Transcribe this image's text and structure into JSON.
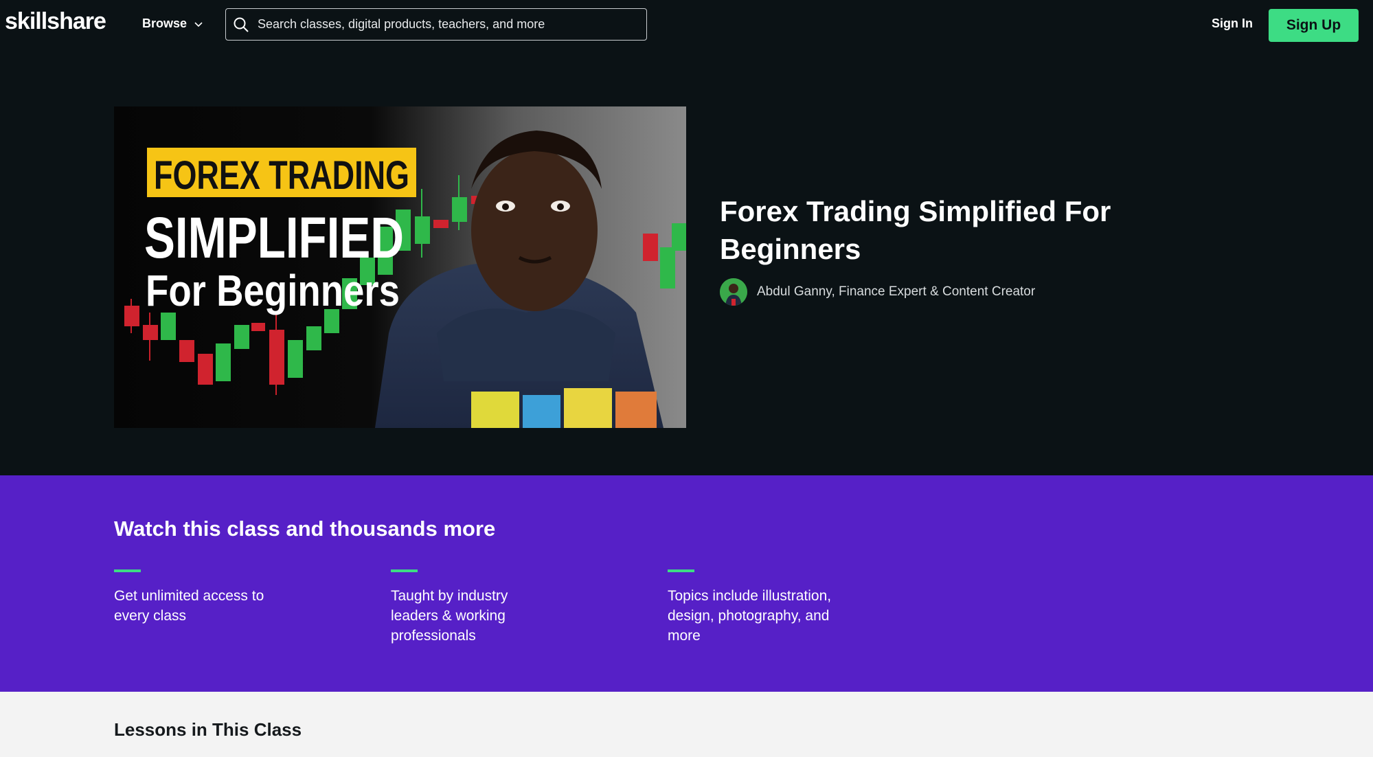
{
  "header": {
    "logo": "skillshare",
    "browse_label": "Browse",
    "search_placeholder": "Search classes, digital products, teachers, and more",
    "signin_label": "Sign In",
    "signup_label": "Sign Up"
  },
  "hero": {
    "thumbnail": {
      "line1": "FOREX TRADING",
      "line2": "SIMPLIFIED",
      "line3": "For Beginners"
    },
    "title": "Forex Trading Simplified For Beginners",
    "teacher": "Abdul Ganny, Finance Expert & Content Creator"
  },
  "promo": {
    "title": "Watch this class and thousands more",
    "features": [
      {
        "text": "Get unlimited access to every class"
      },
      {
        "text": "Taught by industry leaders & working professionals"
      },
      {
        "text": "Topics include illustration, design, photography, and more"
      }
    ]
  },
  "lessons": {
    "title": "Lessons in This Class"
  },
  "colors": {
    "background": "#0b1215",
    "accent_green": "#3ddc84",
    "promo_purple": "#5620c7",
    "lessons_bg": "#f3f3f3"
  }
}
